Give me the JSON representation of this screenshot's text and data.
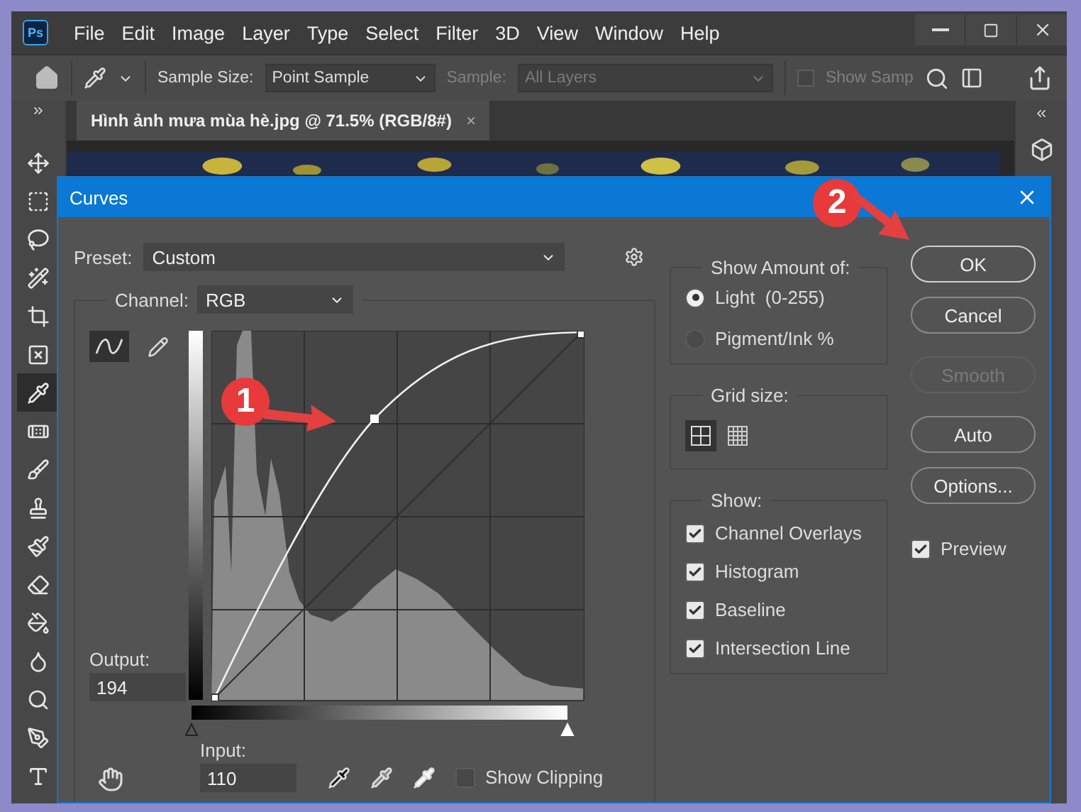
{
  "app": {
    "logo": "Ps",
    "menu": [
      "File",
      "Edit",
      "Image",
      "Layer",
      "Type",
      "Select",
      "Filter",
      "3D",
      "View",
      "Window",
      "Help"
    ],
    "options_bar": {
      "sample_size_label": "Sample Size:",
      "sample_size_value": "Point Sample",
      "sample_label": "Sample:",
      "sample_value": "All Layers",
      "show_sampling": {
        "label": "Show Samp",
        "checked": false,
        "disabled": true
      }
    },
    "document_tab": {
      "title": "Hình ảnh mưa mùa hè.jpg @ 71.5% (RGB/8#)",
      "close": "×"
    },
    "tools": [
      {
        "selected": false
      },
      {
        "selected": false
      },
      {
        "selected": false
      },
      {
        "selected": false
      },
      {
        "selected": false
      },
      {
        "selected": false
      },
      {
        "selected": true
      },
      {
        "selected": false
      },
      {
        "selected": false
      },
      {
        "selected": false
      },
      {
        "selected": false
      },
      {
        "selected": false
      },
      {
        "selected": false
      },
      {
        "selected": false
      },
      {
        "selected": false
      },
      {
        "selected": false
      },
      {
        "selected": false
      }
    ]
  },
  "dialog": {
    "title": "Curves",
    "preset_label": "Preset:",
    "preset_value": "Custom",
    "channel_label": "Channel:",
    "channel_value": "RGB",
    "curve_modes": [
      {
        "selected": true
      },
      {
        "selected": false
      }
    ],
    "output_label": "Output:",
    "output_value": "194",
    "input_label": "Input:",
    "input_value": "110",
    "input_sliders": [
      {
        "kind": "shadow",
        "level": 0
      },
      {
        "kind": "highlight",
        "level": 1
      }
    ],
    "show_clipping": {
      "label": "Show Clipping",
      "checked": false
    },
    "show_amount": {
      "legend": "Show Amount of:",
      "options": [
        {
          "label": "Light  (0-255)",
          "selected": true
        },
        {
          "label": "Pigment/Ink %",
          "selected": false
        }
      ]
    },
    "grid_size": {
      "legend": "Grid size:",
      "options": [
        {
          "selected": true
        },
        {
          "selected": false
        }
      ]
    },
    "show": {
      "legend": "Show:",
      "options": [
        {
          "label": "Channel Overlays",
          "checked": true
        },
        {
          "label": "Histogram",
          "checked": true
        },
        {
          "label": "Baseline",
          "checked": true
        },
        {
          "label": "Intersection Line",
          "checked": true
        }
      ]
    },
    "buttons": [
      {
        "label": "OK",
        "default": true,
        "disabled": false
      },
      {
        "label": "Cancel",
        "default": false,
        "disabled": false
      },
      {
        "label": "Smooth",
        "default": false,
        "disabled": true
      },
      {
        "label": "Auto",
        "default": false,
        "disabled": false
      },
      {
        "label": "Options...",
        "default": false,
        "disabled": false
      }
    ],
    "preview": {
      "label": "Preview",
      "checked": true
    }
  },
  "annotations": [
    {
      "label": "1"
    },
    {
      "label": "2"
    }
  ]
}
